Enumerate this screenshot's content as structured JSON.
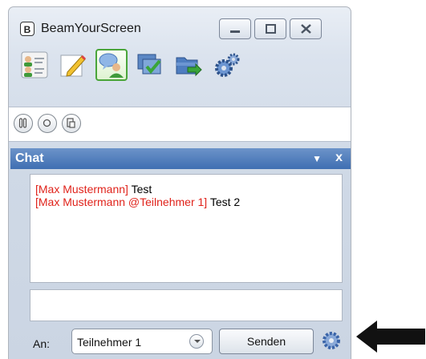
{
  "window": {
    "app_icon_letter": "B",
    "title": "BeamYourScreen"
  },
  "toolbar": {
    "items": [
      {
        "icon": "participants-list-icon",
        "active": false
      },
      {
        "icon": "pencil-annotate-icon",
        "active": false
      },
      {
        "icon": "chat-person-icon",
        "active": true
      },
      {
        "icon": "presentation-check-icon",
        "active": false
      },
      {
        "icon": "folder-transfer-icon",
        "active": false
      },
      {
        "icon": "settings-gears-icon",
        "active": false
      }
    ]
  },
  "controls": [
    "pause-icon",
    "record-icon",
    "clipboard-icon"
  ],
  "chat": {
    "title": "Chat",
    "close_glyph": "x",
    "messages": [
      {
        "sender": "[Max Mustermann]",
        "text": " Test"
      },
      {
        "sender": "[Max Mustermann @Teilnehmer 1]",
        "text": " Test 2"
      }
    ],
    "input_value": "",
    "to_label": "An:",
    "recipient": "Teilnehmer 1",
    "send_label": "Senden"
  },
  "colors": {
    "sender_red": "#e0231b",
    "header_blue": "#4a78b8",
    "active_green": "#4aa53a"
  }
}
